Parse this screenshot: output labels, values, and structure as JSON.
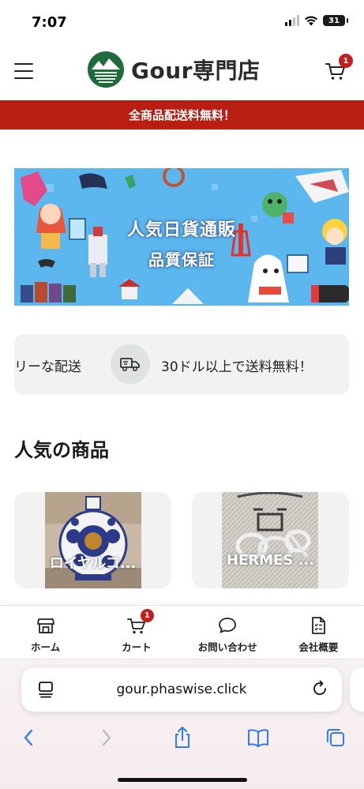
{
  "status_bar": {
    "time": "7:07",
    "battery": "31"
  },
  "header": {
    "brand": "Gour専門店",
    "cart_count": "1"
  },
  "promo": {
    "text": "全商品配送料無料！"
  },
  "banner": {
    "line1": "人気日貨通販",
    "line2": "品質保証"
  },
  "features": {
    "left_text": "リーな配送",
    "right_text": "30ドル以上で送料無料！"
  },
  "section": {
    "title": "人気の商品"
  },
  "products": [
    {
      "name": "ロイヤルコ..."
    },
    {
      "name": "HERMES ..."
    }
  ],
  "bottom_nav": {
    "home": "ホーム",
    "cart": "カート",
    "cart_count": "1",
    "contact": "お問い合わせ",
    "company": "会社概要"
  },
  "browser": {
    "url": "gour.phaswise.click"
  },
  "colors": {
    "promo_red": "#b81e12",
    "badge_red": "#c31f1f",
    "banner_blue": "#5cb7ee",
    "browser_blue": "#2f7cf6",
    "logo_green": "#1f6b3a"
  }
}
